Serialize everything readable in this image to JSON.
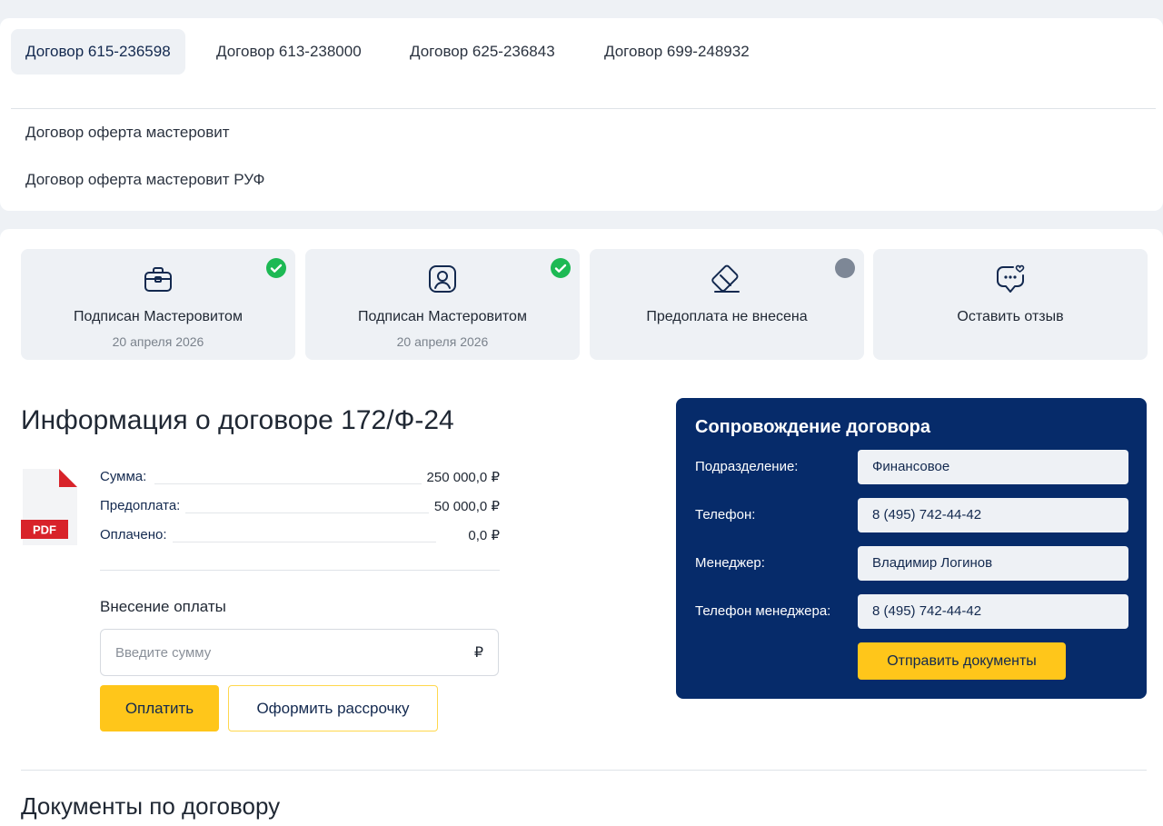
{
  "tabs": [
    {
      "label": "Договор 615-236598",
      "active": true
    },
    {
      "label": "Договор 613-238000",
      "active": false
    },
    {
      "label": "Договор 625-236843",
      "active": false
    },
    {
      "label": "Договор 699-248932",
      "active": false
    }
  ],
  "offers": [
    "Договор оферта мастеровит",
    "Договор оферта мастеровит РУФ"
  ],
  "statuses": [
    {
      "icon": "briefcase-icon",
      "label": "Подписан Мастеровитом",
      "date": "20 апреля 2026",
      "state": "done"
    },
    {
      "icon": "user-badge-icon",
      "label": "Подписан Мастеровитом",
      "date": "20 апреля 2026",
      "state": "done"
    },
    {
      "icon": "card-slash-icon",
      "label": "Предоплата не внесена",
      "date": "",
      "state": "pending"
    },
    {
      "icon": "chat-heart-icon",
      "label": "Оставить отзыв",
      "date": "",
      "state": "none"
    }
  ],
  "info": {
    "title": "Информация о договоре 172/Ф-24",
    "pdf_label": "PDF",
    "rows": [
      {
        "label": "Сумма:",
        "value": "250 000,0 ₽"
      },
      {
        "label": "Предоплата:",
        "value": "50 000,0 ₽"
      },
      {
        "label": "Оплачено:",
        "value": "0,0 ₽"
      }
    ]
  },
  "payment": {
    "title": "Внесение оплаты",
    "placeholder": "Введите сумму",
    "currency": "₽",
    "pay_label": "Оплатить",
    "installment_label": "Оформить рассрочку"
  },
  "support": {
    "title": "Сопровождение договора",
    "rows": [
      {
        "label": "Подразделение:",
        "value": "Финансовое"
      },
      {
        "label": "Телефон:",
        "value": "8 (495) 742-44-42"
      },
      {
        "label": "Менеджер:",
        "value": "Владимир Логинов"
      },
      {
        "label": "Телефон менеджера:",
        "value": "8 (495) 742-44-42"
      }
    ],
    "send_label": "Отправить документы"
  },
  "documents": {
    "title": "Документы по договору"
  },
  "colors": {
    "accent": "#ffc61a",
    "navy": "#062b6a",
    "success": "#1db954",
    "pending": "#7d8796",
    "pdf_red": "#d8232a"
  }
}
